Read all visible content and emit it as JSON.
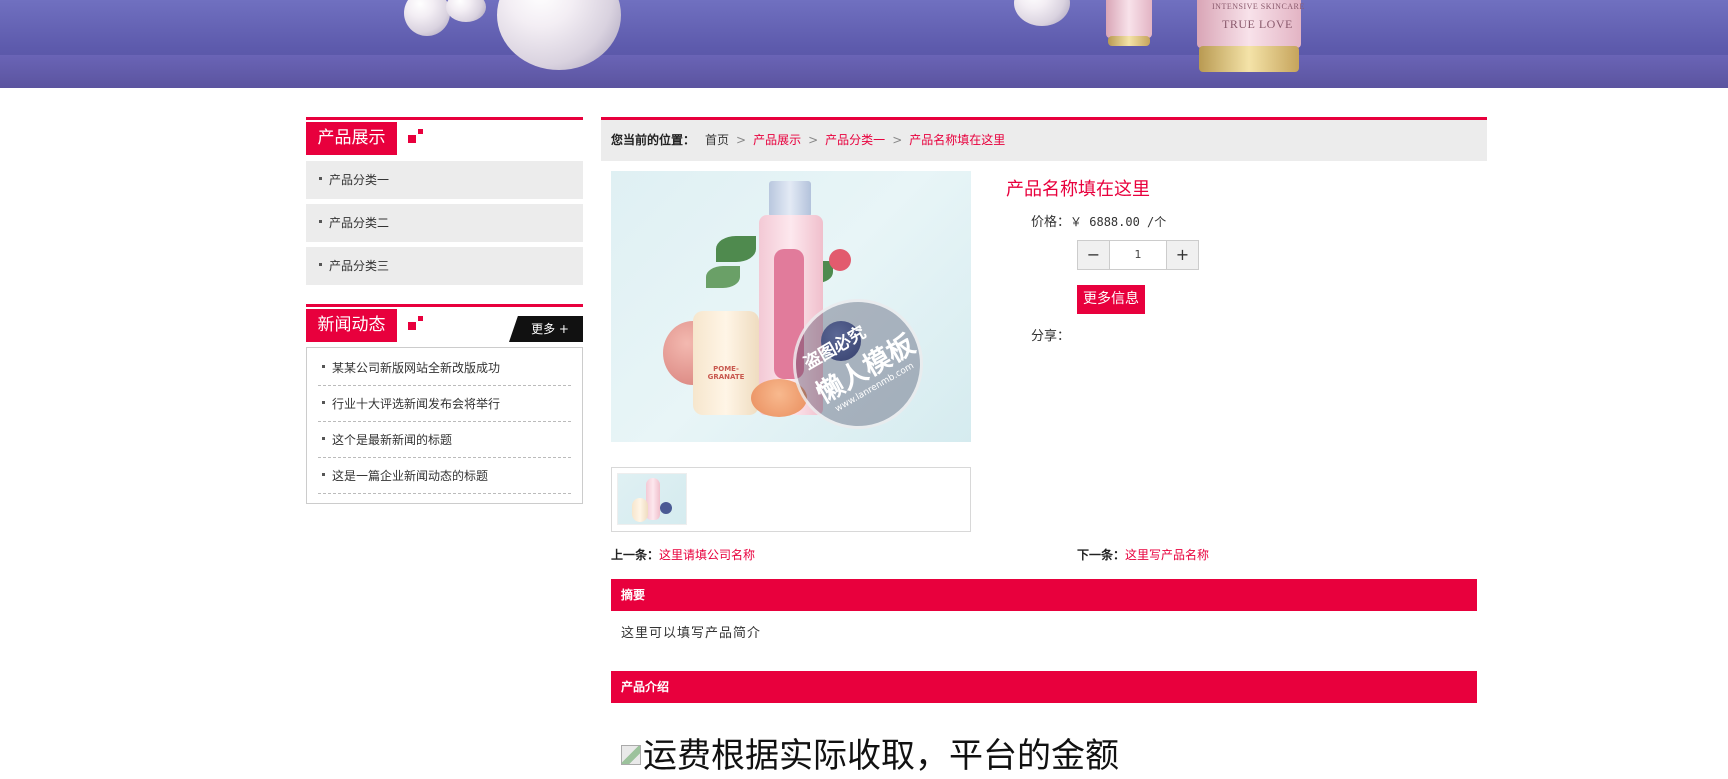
{
  "banner": {
    "bottle_text_top": "INTENSIVE SKINCARE",
    "bottle_text_main": "TRUE LOVE"
  },
  "sidebar": {
    "products": {
      "title": "产品展示",
      "items": [
        {
          "label": "产品分类一"
        },
        {
          "label": "产品分类二"
        },
        {
          "label": "产品分类三"
        }
      ]
    },
    "news": {
      "title": "新闻动态",
      "more_label": "更多 +",
      "items": [
        {
          "label": "某某公司新版网站全新改版成功"
        },
        {
          "label": "行业十大评选新闻发布会将举行"
        },
        {
          "label": "这个是最新新闻的标题"
        },
        {
          "label": "这是一篇企业新闻动态的标题"
        }
      ]
    }
  },
  "breadcrumb": {
    "label": "您当前的位置：",
    "home": "首页",
    "links": [
      "产品展示",
      "产品分类一",
      "产品名称填在这里"
    ],
    "separator": ">"
  },
  "product": {
    "name": "产品名称填在这里",
    "price_label": "价格：",
    "price_value": "￥ 6888.00 /个",
    "quantity": "1",
    "minus": "−",
    "plus": "+",
    "more_info": "更多信息",
    "share_label": "分享：",
    "watermark_line1": "盗图必究",
    "watermark_line2": "懒人模板",
    "watermark_line3": "www.lanrenmb.com",
    "image_text": "POME-GRANATE"
  },
  "prevnext": {
    "prev_label": "上一条：",
    "prev_link": "这里请填公司名称",
    "next_label": "下一条：",
    "next_link": "这里写产品名称"
  },
  "sections": {
    "summary_title": "摘要",
    "summary_text": "这里可以填写产品简介",
    "intro_title": "产品介绍",
    "intro_text": "运费根据实际收取，平台的金额"
  },
  "colors": {
    "accent": "#e8003d",
    "banner": "#5d5aac",
    "panel": "#ececec"
  }
}
